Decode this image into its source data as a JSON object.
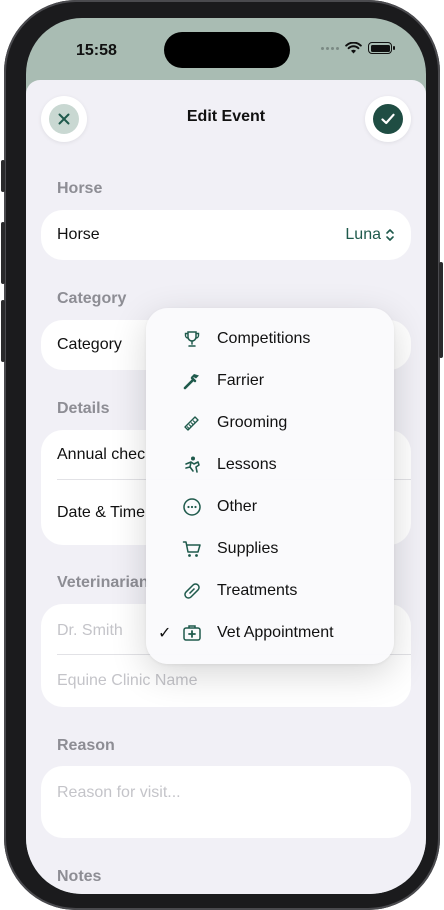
{
  "status_bar": {
    "time": "15:58"
  },
  "nav": {
    "title": "Edit Event",
    "cancel_icon": "close-icon",
    "save_icon": "checkmark-icon"
  },
  "colors": {
    "accent": "#1f5a4c",
    "sheet_bg": "#f1f0f6",
    "card_bg": "#ffffff",
    "section_label": "#8d8d94"
  },
  "horse_section": {
    "label": "Horse",
    "row_label": "Horse",
    "value": "Luna"
  },
  "category_section": {
    "label": "Category",
    "row_label": "Category"
  },
  "details_section": {
    "label": "Details",
    "title_value": "Annual chec",
    "date_label": "Date & Time"
  },
  "vet_section": {
    "label": "Veterinarian",
    "name_placeholder": "Dr. Smith",
    "clinic_placeholder": "Equine Clinic Name"
  },
  "reason_section": {
    "label": "Reason",
    "placeholder": "Reason for visit..."
  },
  "notes_section": {
    "label": "Notes"
  },
  "category_menu": {
    "items": [
      {
        "label": "Competitions",
        "icon": "trophy-icon",
        "selected": false
      },
      {
        "label": "Farrier",
        "icon": "hammer-icon",
        "selected": false
      },
      {
        "label": "Grooming",
        "icon": "comb-icon",
        "selected": false
      },
      {
        "label": "Lessons",
        "icon": "rider-icon",
        "selected": false
      },
      {
        "label": "Other",
        "icon": "ellipsis-circle-icon",
        "selected": false
      },
      {
        "label": "Supplies",
        "icon": "cart-icon",
        "selected": false
      },
      {
        "label": "Treatments",
        "icon": "pill-icon",
        "selected": false
      },
      {
        "label": "Vet Appointment",
        "icon": "medical-kit-icon",
        "selected": true
      }
    ],
    "check_mark": "✓"
  }
}
